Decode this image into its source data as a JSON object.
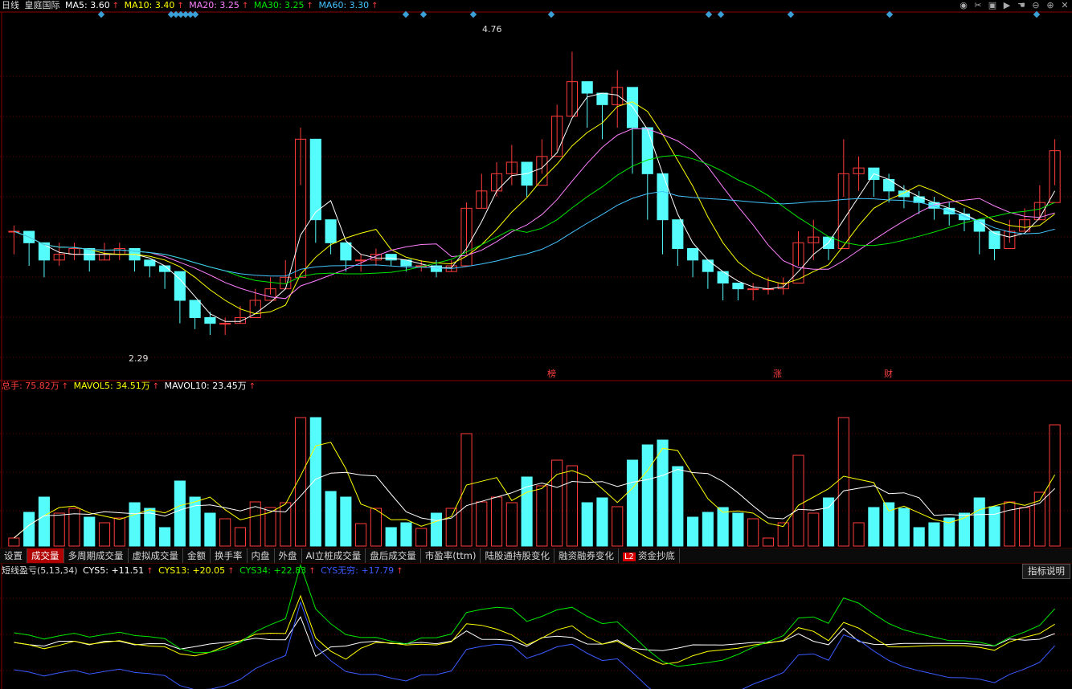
{
  "main_header": {
    "period": "日线",
    "stock": "皇庭国际",
    "ma5": "MA5: 3.60",
    "ma10": "MA10: 3.40",
    "ma20": "MA20: 3.25",
    "ma30": "MA30: 3.25",
    "ma60": "MA60: 3.30",
    "arrow": "↑"
  },
  "price_annotations": {
    "high": "4.76",
    "low": "2.29"
  },
  "event_markers": [
    "榜",
    "涨",
    "财"
  ],
  "volume_header": {
    "total": "总手: 75.82万",
    "mavol5": "MAVOL5: 34.51万",
    "mavol10": "MAVOL10: 23.45万",
    "arrow": "↑"
  },
  "tabs": [
    {
      "label": "设置"
    },
    {
      "label": "成交量",
      "active": true
    },
    {
      "label": "多周期成交量"
    },
    {
      "label": "虚拟成交量"
    },
    {
      "label": "金额"
    },
    {
      "label": "换手率"
    },
    {
      "label": "内盘"
    },
    {
      "label": "外盘"
    },
    {
      "label": "AI立桩成交量"
    },
    {
      "label": "盘后成交量"
    },
    {
      "label": "市盈率(ttm)"
    },
    {
      "label": "陆股通持股变化"
    },
    {
      "label": "融资融券变化"
    },
    {
      "label": "资金抄底",
      "badge": "L2"
    }
  ],
  "indicator_header": {
    "name": "短线盈亏(5,13,34)",
    "cys5": "CYS5: +11.51",
    "cys13": "CYS13: +20.05",
    "cys34": "CYS34: +22.83",
    "cysinf": "CYS无穷: +17.79",
    "arrow": "↑"
  },
  "explain_button": "指标说明",
  "top_icons": [
    "eye-icon",
    "scissors-icon",
    "lock-icon",
    "play-icon",
    "hand-icon",
    "minus-icon",
    "plus-icon",
    "close-icon"
  ],
  "colors": {
    "up": "#ff3c3c",
    "down": "#54fcfc",
    "ma5": "#ffffff",
    "ma10": "#ffff00",
    "ma20": "#ff80ff",
    "ma30": "#00e600",
    "ma60": "#44c4ff",
    "cysinf": "#3b5bff",
    "grid": "#6b0000"
  },
  "chart_data": {
    "type": "candlestick",
    "price_range": [
      2.0,
      5.0
    ],
    "price_high_marker": 4.76,
    "price_low_marker": 2.29,
    "candles_approx": [
      [
        3.2,
        3.25,
        3.0
      ],
      [
        3.1,
        3.15,
        2.9
      ],
      [
        2.95,
        3.05,
        2.8
      ],
      [
        3.0,
        3.1,
        2.9
      ],
      [
        3.05,
        3.1,
        2.95
      ],
      [
        2.95,
        3.0,
        2.85
      ],
      [
        3.0,
        3.1,
        2.95
      ],
      [
        3.05,
        3.1,
        2.95
      ],
      [
        2.95,
        3.0,
        2.85
      ],
      [
        2.9,
        2.95,
        2.8
      ],
      [
        2.85,
        2.9,
        2.7
      ],
      [
        2.6,
        2.65,
        2.4
      ],
      [
        2.45,
        2.55,
        2.35
      ],
      [
        2.4,
        2.5,
        2.3
      ],
      [
        2.4,
        2.45,
        2.3
      ],
      [
        2.45,
        2.55,
        2.4
      ],
      [
        2.6,
        2.7,
        2.55
      ],
      [
        2.7,
        2.8,
        2.65
      ],
      [
        2.8,
        2.95,
        2.75
      ],
      [
        4.0,
        4.1,
        3.6
      ],
      [
        3.3,
        3.4,
        3.1
      ],
      [
        3.1,
        3.2,
        3.0
      ],
      [
        2.95,
        3.05,
        2.85
      ],
      [
        2.95,
        3.0,
        2.85
      ],
      [
        3.0,
        3.05,
        2.9
      ],
      [
        2.95,
        3.0,
        2.9
      ],
      [
        2.9,
        2.95,
        2.85
      ],
      [
        2.9,
        2.95,
        2.85
      ],
      [
        2.85,
        2.95,
        2.8
      ],
      [
        2.9,
        2.95,
        2.85
      ],
      [
        3.4,
        3.45,
        3.0
      ],
      [
        3.55,
        3.7,
        3.4
      ],
      [
        3.7,
        3.8,
        3.5
      ],
      [
        3.8,
        3.95,
        3.6
      ],
      [
        3.6,
        3.75,
        3.5
      ],
      [
        3.85,
        4.0,
        3.7
      ],
      [
        4.2,
        4.3,
        3.9
      ],
      [
        4.5,
        4.76,
        4.2
      ],
      [
        4.4,
        4.5,
        4.1
      ],
      [
        4.3,
        4.4,
        4.0
      ],
      [
        4.45,
        4.6,
        4.1
      ],
      [
        4.1,
        4.25,
        3.7
      ],
      [
        3.7,
        3.8,
        3.3
      ],
      [
        3.3,
        3.35,
        3.0
      ],
      [
        3.05,
        3.1,
        2.9
      ],
      [
        2.95,
        3.0,
        2.8
      ],
      [
        2.85,
        2.9,
        2.7
      ],
      [
        2.75,
        2.8,
        2.6
      ],
      [
        2.7,
        2.75,
        2.6
      ],
      [
        2.7,
        2.75,
        2.6
      ],
      [
        2.7,
        2.8,
        2.65
      ],
      [
        2.75,
        2.8,
        2.65
      ],
      [
        3.1,
        3.2,
        2.9
      ],
      [
        3.15,
        3.3,
        2.95
      ],
      [
        3.05,
        3.1,
        2.95
      ],
      [
        3.7,
        4.0,
        3.5
      ],
      [
        3.75,
        3.85,
        3.55
      ],
      [
        3.65,
        3.75,
        3.5
      ],
      [
        3.55,
        3.7,
        3.45
      ],
      [
        3.5,
        3.6,
        3.4
      ],
      [
        3.45,
        3.55,
        3.35
      ],
      [
        3.4,
        3.5,
        3.3
      ],
      [
        3.35,
        3.45,
        3.25
      ],
      [
        3.3,
        3.4,
        3.2
      ],
      [
        3.2,
        3.3,
        3.0
      ],
      [
        3.05,
        3.15,
        2.95
      ],
      [
        3.2,
        3.3,
        3.1
      ],
      [
        3.3,
        3.4,
        3.2
      ],
      [
        3.45,
        3.6,
        3.3
      ],
      [
        3.9,
        4.0,
        3.6
      ]
    ]
  }
}
